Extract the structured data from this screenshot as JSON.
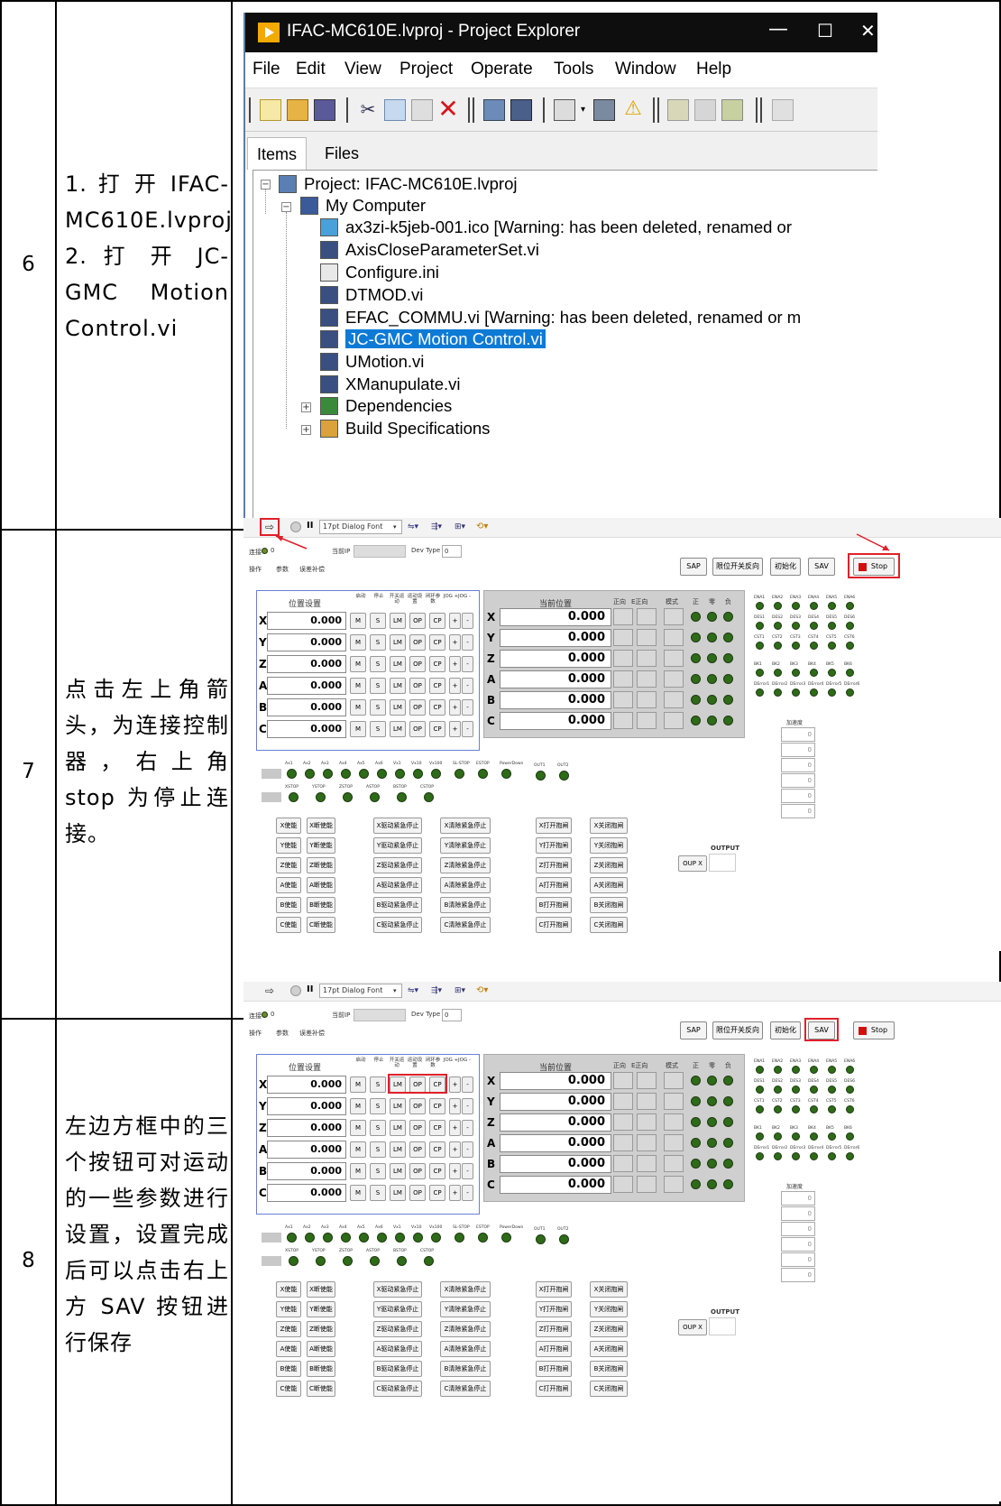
{
  "rows": [
    {
      "num": "6",
      "desc": "1. 打 开 IFAC-MC610E.lvproj 2. 打 开 JC-GMC Motion Control.vi"
    },
    {
      "num": "7",
      "desc": "点击左上角箭头，为连接控制器，右上角 stop 为停止连接。"
    },
    {
      "num": "8",
      "desc": "左边方框中的三个按钮可对运动的一些参数进行设置，设置完成后可以点击右上方 SAV 按钮进行保存"
    }
  ],
  "explorer": {
    "title": "IFAC-MC610E.lvproj - Project Explorer",
    "window_controls": [
      "—",
      "☐",
      "✕"
    ],
    "menu": [
      "File",
      "Edit",
      "View",
      "Project",
      "Operate",
      "Tools",
      "Window",
      "Help"
    ],
    "tabs": [
      "Items",
      "Files"
    ],
    "tree": [
      "Project: IFAC-MC610E.lvproj",
      "My Computer",
      "ax3zi-k5jeb-001.ico  [Warning:  has been deleted, renamed or",
      "AxisCloseParameterSet.vi",
      "Configure.ini",
      "DTMOD.vi",
      "EFAC_COMMU.vi  [Warning:  has been deleted, renamed or m",
      "JC-GMC Motion Control.vi",
      "UMotion.vi",
      "XManupulate.vi",
      "Dependencies",
      "Build Specifications"
    ]
  },
  "panel": {
    "font": "17pt Dialog Font",
    "connect": "连接",
    "connect_val": "0",
    "status": "当前IP",
    "devtype": "Dev Type",
    "devtype_val": "0",
    "tabs": [
      "操作",
      "参数",
      "误差补偿"
    ],
    "sap": "SAP",
    "limit": "限位开关反向",
    "init": "初始化",
    "sav": "SAV",
    "stop": "Stop",
    "pos_title": "位置设置",
    "cur_title": "当前位置",
    "col_heads": [
      "启动",
      "停止",
      "开关运动",
      "运动设置",
      "闭环参数",
      "JOG +",
      "JOG -"
    ],
    "cur_heads": [
      "正向",
      "E正向",
      "模式",
      "正",
      "零",
      "负"
    ],
    "axes": [
      "X",
      "Y",
      "Z",
      "A",
      "B",
      "C"
    ],
    "value": "0.000",
    "btns": [
      "M",
      "S",
      "LM",
      "OP",
      "CP",
      "+",
      "-"
    ],
    "ena": [
      "ENA1",
      "ENA2",
      "ENA3",
      "ENA4",
      "ENA5",
      "ENA6"
    ],
    "des": [
      "DES1",
      "DES2",
      "DES3",
      "DES4",
      "DES5",
      "DES6"
    ],
    "cst": [
      "CST1",
      "CST2",
      "CST3",
      "CST4",
      "CST5",
      "CST6"
    ],
    "bk": [
      "BK1",
      "BK2",
      "BK3",
      "BK4",
      "BK5",
      "BK6"
    ],
    "derr": [
      "DError1",
      "DError2",
      "DError3",
      "DError4",
      "DError5",
      "DError6"
    ],
    "accel": "加速度",
    "accel_val": "0",
    "ax_leds": [
      "Ax1",
      "Ax2",
      "Ax3",
      "Ax4",
      "Ax5",
      "Ax6",
      "Vx1",
      "Vx10",
      "Vx100",
      "SL-STOP",
      "ESTOP",
      "PowerDown"
    ],
    "outs": [
      "OUT1",
      "OUT2"
    ],
    "stops": [
      "XSTOP",
      "YSTOP",
      "ZSTOP",
      "ASTOP",
      "BSTOP",
      "CSTOP"
    ],
    "output": "OUTPUT",
    "oup": "OUP X",
    "enable": [
      "X使能",
      "Y使能",
      "Z使能",
      "A使能",
      "B使能",
      "C使能"
    ],
    "disable": [
      "X断使能",
      "Y断使能",
      "Z断使能",
      "A断使能",
      "B断使能",
      "C断使能"
    ],
    "estop": [
      "X驱动紧急停止",
      "Y驱动紧急停止",
      "Z驱动紧急停止",
      "A驱动紧急停止",
      "B驱动紧急停止",
      "C驱动紧急停止"
    ],
    "clr": [
      "X清除紧急停止",
      "Y清除紧急停止",
      "Z清除紧急停止",
      "A清除紧急停止",
      "B清除紧急停止",
      "C清除紧急停止"
    ],
    "brk_on": [
      "X打开抱闸",
      "Y打开抱闸",
      "Z打开抱闸",
      "A打开抱闸",
      "B打开抱闸",
      "C打开抱闸"
    ],
    "brk_off": [
      "X关闭抱闸",
      "Y关闭抱闸",
      "Z关闭抱闸",
      "A关闭抱闸",
      "B关闭抱闸",
      "C关闭抱闸"
    ]
  }
}
